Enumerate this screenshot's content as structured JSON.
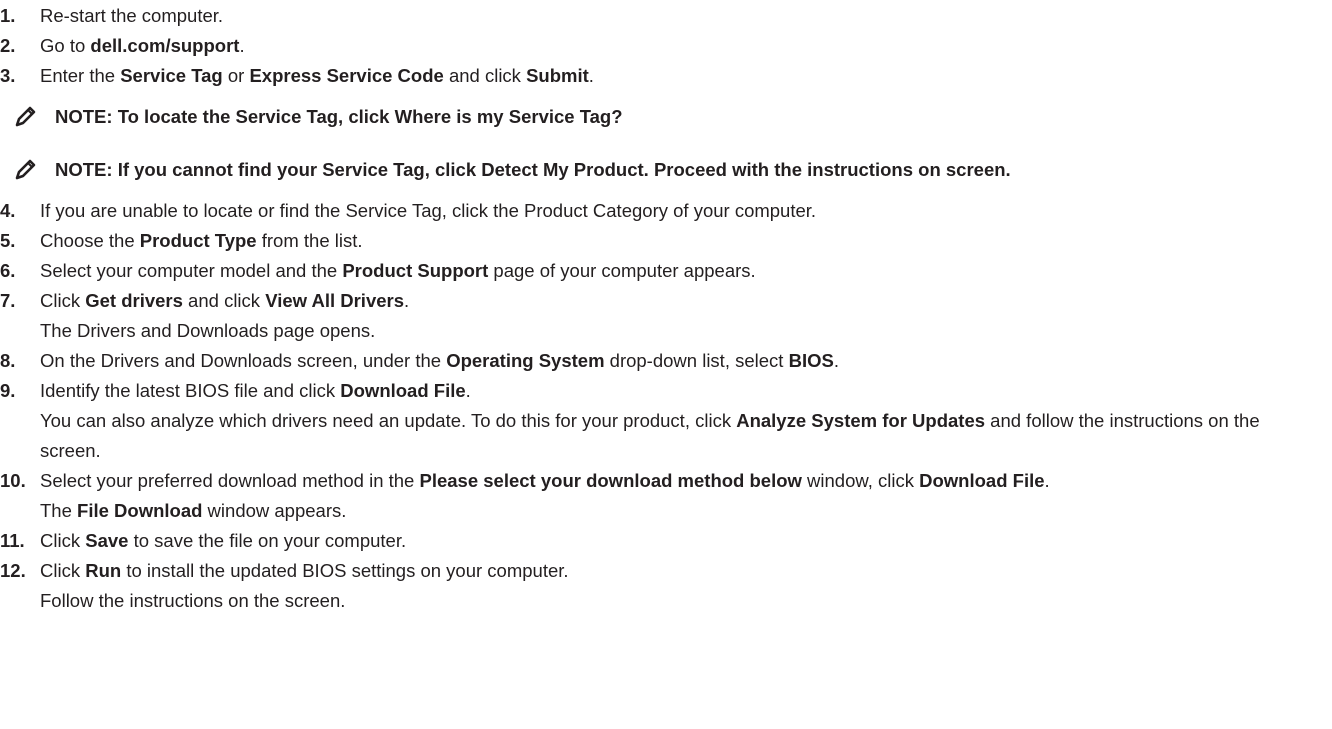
{
  "steps": [
    {
      "num": "1.",
      "segments": [
        {
          "t": "Re-start the computer.",
          "b": false
        }
      ]
    },
    {
      "num": "2.",
      "segments": [
        {
          "t": "Go to ",
          "b": false
        },
        {
          "t": "dell.com/support",
          "b": true
        },
        {
          "t": ".",
          "b": false
        }
      ]
    },
    {
      "num": "3.",
      "segments": [
        {
          "t": "Enter the ",
          "b": false
        },
        {
          "t": "Service Tag",
          "b": true
        },
        {
          "t": " or ",
          "b": false
        },
        {
          "t": "Express Service Code",
          "b": true
        },
        {
          "t": " and click ",
          "b": false
        },
        {
          "t": "Submit",
          "b": true
        },
        {
          "t": ".",
          "b": false
        }
      ]
    },
    {
      "num": "4.",
      "segments": [
        {
          "t": "If you are unable to locate or find the Service Tag, click the Product Category of your computer.",
          "b": false
        }
      ]
    },
    {
      "num": "5.",
      "segments": [
        {
          "t": "Choose the ",
          "b": false
        },
        {
          "t": "Product Type",
          "b": true
        },
        {
          "t": " from the list.",
          "b": false
        }
      ]
    },
    {
      "num": "6.",
      "segments": [
        {
          "t": "Select your computer model and the ",
          "b": false
        },
        {
          "t": "Product Support",
          "b": true
        },
        {
          "t": " page of your computer appears.",
          "b": false
        }
      ]
    },
    {
      "num": "7.",
      "segments": [
        {
          "t": "Click ",
          "b": false
        },
        {
          "t": "Get drivers",
          "b": true
        },
        {
          "t": " and click ",
          "b": false
        },
        {
          "t": "View All Drivers",
          "b": true
        },
        {
          "t": ".",
          "b": false
        }
      ]
    },
    {
      "num": "8.",
      "segments": [
        {
          "t": "On the Drivers and Downloads screen, under the ",
          "b": false
        },
        {
          "t": "Operating System",
          "b": true
        },
        {
          "t": " drop-down list, select ",
          "b": false
        },
        {
          "t": "BIOS",
          "b": true
        },
        {
          "t": ".",
          "b": false
        }
      ]
    },
    {
      "num": "9.",
      "segments": [
        {
          "t": "Identify the latest BIOS file and click ",
          "b": false
        },
        {
          "t": "Download File",
          "b": true
        },
        {
          "t": ".",
          "b": false
        }
      ]
    },
    {
      "num": "10.",
      "segments": [
        {
          "t": "Select your preferred download method in the ",
          "b": false
        },
        {
          "t": "Please select your download method below",
          "b": true
        },
        {
          "t": " window, click ",
          "b": false
        },
        {
          "t": "Download File",
          "b": true
        },
        {
          "t": ".",
          "b": false
        }
      ]
    },
    {
      "num": "11.",
      "segments": [
        {
          "t": "Click ",
          "b": false
        },
        {
          "t": "Save",
          "b": true
        },
        {
          "t": " to save the file on your computer.",
          "b": false
        }
      ]
    },
    {
      "num": "12.",
      "segments": [
        {
          "t": "Click ",
          "b": false
        },
        {
          "t": "Run",
          "b": true
        },
        {
          "t": " to install the updated BIOS settings on your computer.",
          "b": false
        }
      ]
    }
  ],
  "notes": [
    {
      "icon": "note-pencil-icon",
      "text": "NOTE: To locate the Service Tag, click Where is my Service Tag?"
    },
    {
      "icon": "note-pencil-icon",
      "text": "NOTE: If you cannot find your Service Tag, click Detect My Product. Proceed with the instructions on screen."
    }
  ],
  "continuations": {
    "step7": [
      {
        "t": "The Drivers and Downloads page opens.",
        "b": false
      }
    ],
    "step9": [
      {
        "t": "You can also analyze which drivers need an update. To do this for your product, click ",
        "b": false
      },
      {
        "t": "Analyze System for Updates",
        "b": true
      },
      {
        "t": " and follow the instructions on the screen.",
        "b": false
      }
    ],
    "step10": [
      {
        "t": "The ",
        "b": false
      },
      {
        "t": "File Download",
        "b": true
      },
      {
        "t": " window appears.",
        "b": false
      }
    ],
    "step12": [
      {
        "t": "Follow the instructions on the screen.",
        "b": false
      }
    ]
  },
  "colors": {
    "text": "#231f20",
    "icon": "#231f20",
    "background": "#ffffff"
  }
}
